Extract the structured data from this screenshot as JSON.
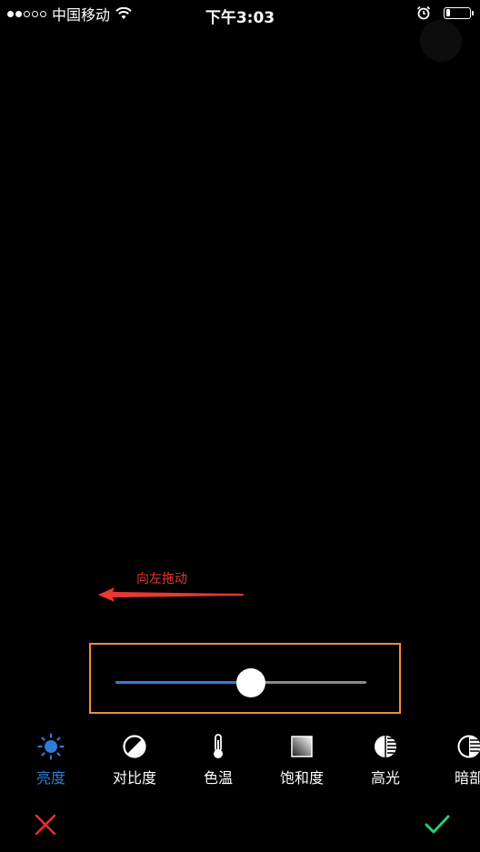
{
  "status_bar": {
    "carrier": "中国移动",
    "time": "下午3:03",
    "signal_bars_filled": 2,
    "signal_bars_total": 5,
    "battery_level": 0.2
  },
  "annotation": {
    "text": "向左拖动",
    "color": "#e8382f"
  },
  "slider": {
    "value": 0.5,
    "highlight_color": "#ef8d3b",
    "fill_color": "#2f7bd8"
  },
  "tools": [
    {
      "label": "亮度",
      "icon": "sun-icon",
      "active": true
    },
    {
      "label": "对比度",
      "icon": "contrast-icon",
      "active": false
    },
    {
      "label": "色温",
      "icon": "thermometer-icon",
      "active": false
    },
    {
      "label": "饱和度",
      "icon": "saturation-icon",
      "active": false
    },
    {
      "label": "高光",
      "icon": "highlights-icon",
      "active": false
    },
    {
      "label": "暗部",
      "icon": "shadows-icon",
      "active": false
    }
  ],
  "actions": {
    "cancel_icon": "close-icon",
    "confirm_icon": "check-icon",
    "cancel_color": "#e0303a",
    "confirm_color": "#2ecc71"
  }
}
